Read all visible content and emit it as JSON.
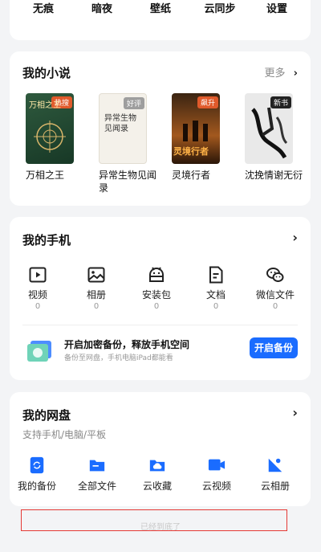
{
  "top_tabs": [
    "无痕",
    "暗夜",
    "壁纸",
    "云同步",
    "设置"
  ],
  "novels": {
    "title": "我的小说",
    "more": "更多",
    "books": [
      {
        "title": "万相之王",
        "badge": "热搜",
        "cover_text": "万相之王",
        "badge_color": "#e05a2b"
      },
      {
        "title": "异常生物见闻录",
        "badge": "好评",
        "cover_text": "异常生物见闻录",
        "badge_color": "#9e9e9e"
      },
      {
        "title": "灵境行者",
        "badge": "飙升",
        "cover_text": "灵境行者",
        "badge_color": "#e05a2b"
      },
      {
        "title": "沈挽情谢无衍",
        "badge": "新书",
        "cover_text": "",
        "badge_color": "#222222"
      }
    ]
  },
  "phone": {
    "title": "我的手机",
    "items": [
      {
        "label": "视频",
        "count": "0",
        "icon": "video-icon"
      },
      {
        "label": "相册",
        "count": "0",
        "icon": "photo-icon"
      },
      {
        "label": "安装包",
        "count": "0",
        "icon": "android-icon"
      },
      {
        "label": "文档",
        "count": "0",
        "icon": "document-icon"
      },
      {
        "label": "微信文件",
        "count": "0",
        "icon": "wechat-icon"
      }
    ],
    "backup": {
      "title": "开启加密备份，释放手机空间",
      "subtitle": "备份至网盘，手机电脑iPad都能看",
      "button": "开启备份"
    }
  },
  "cloud": {
    "title": "我的网盘",
    "subtitle": "支持手机/电脑/平板",
    "items": [
      {
        "label": "我的备份",
        "icon": "backup-icon"
      },
      {
        "label": "全部文件",
        "icon": "folder-icon"
      },
      {
        "label": "云收藏",
        "icon": "cloud-favorite-icon"
      },
      {
        "label": "云视频",
        "icon": "cloud-video-icon"
      },
      {
        "label": "云相册",
        "icon": "cloud-album-icon"
      }
    ]
  },
  "footer": "已经到底了",
  "colors": {
    "accent": "#1a6cff",
    "highlight_box": "#e53935"
  }
}
